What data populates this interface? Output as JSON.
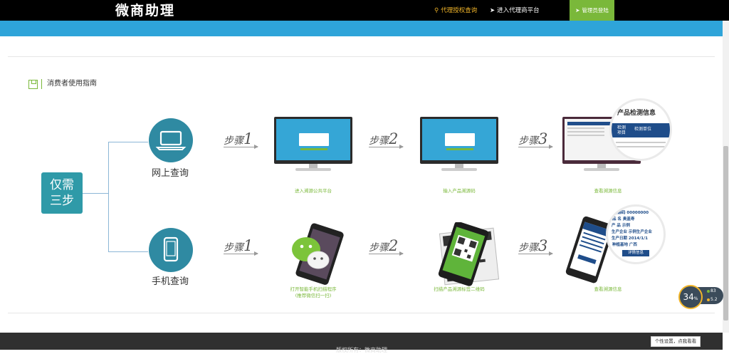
{
  "header": {
    "brand": "微商助理",
    "nav": [
      {
        "label": "代理授权查询",
        "icon": "search-icon"
      },
      {
        "label": "进入代理商平台",
        "icon": "send-icon"
      },
      {
        "label": "管理员登陆",
        "icon": "send-icon"
      }
    ]
  },
  "guide": {
    "title": "消费者使用指南"
  },
  "only": {
    "line1": "仅需",
    "line2": "三步"
  },
  "online": {
    "label": "网上查询",
    "steps": [
      {
        "word": "步骤",
        "num": "1",
        "caption": "进入溯源公共平台"
      },
      {
        "word": "步骤",
        "num": "2",
        "caption": "输入产品溯源码"
      },
      {
        "word": "步骤",
        "num": "3",
        "caption": "查看溯源信息"
      }
    ],
    "result": {
      "title": "产品检测信息",
      "row1a": "检测项目",
      "row1b": "检测单位"
    }
  },
  "mobile": {
    "label": "手机查询",
    "steps": [
      {
        "word": "步骤",
        "num": "1",
        "caption1": "打开智能手机扫描程序",
        "caption2": "(推荐微信扫一扫)"
      },
      {
        "word": "步骤",
        "num": "2",
        "caption1": "扫描产品溯源标签二维码",
        "caption2": ""
      },
      {
        "word": "步骤",
        "num": "3",
        "caption1": "查看溯源信息",
        "caption2": ""
      }
    ],
    "result": {
      "code": "溯源码 00000000",
      "name": "品 名  奥盖寿",
      "product": "产 品  示例",
      "producer": "生产企业 示例生产企业",
      "date": "生产日期 2014/1/1",
      "origin": "种植基地 广西",
      "button": "详情信息"
    }
  },
  "footer": {
    "copyright": "版权所有：微商助理"
  },
  "widget": {
    "speed": "34",
    "unit": "%",
    "up": "83",
    "down": "5.2",
    "tooltip": "个性设置，点我看看"
  }
}
